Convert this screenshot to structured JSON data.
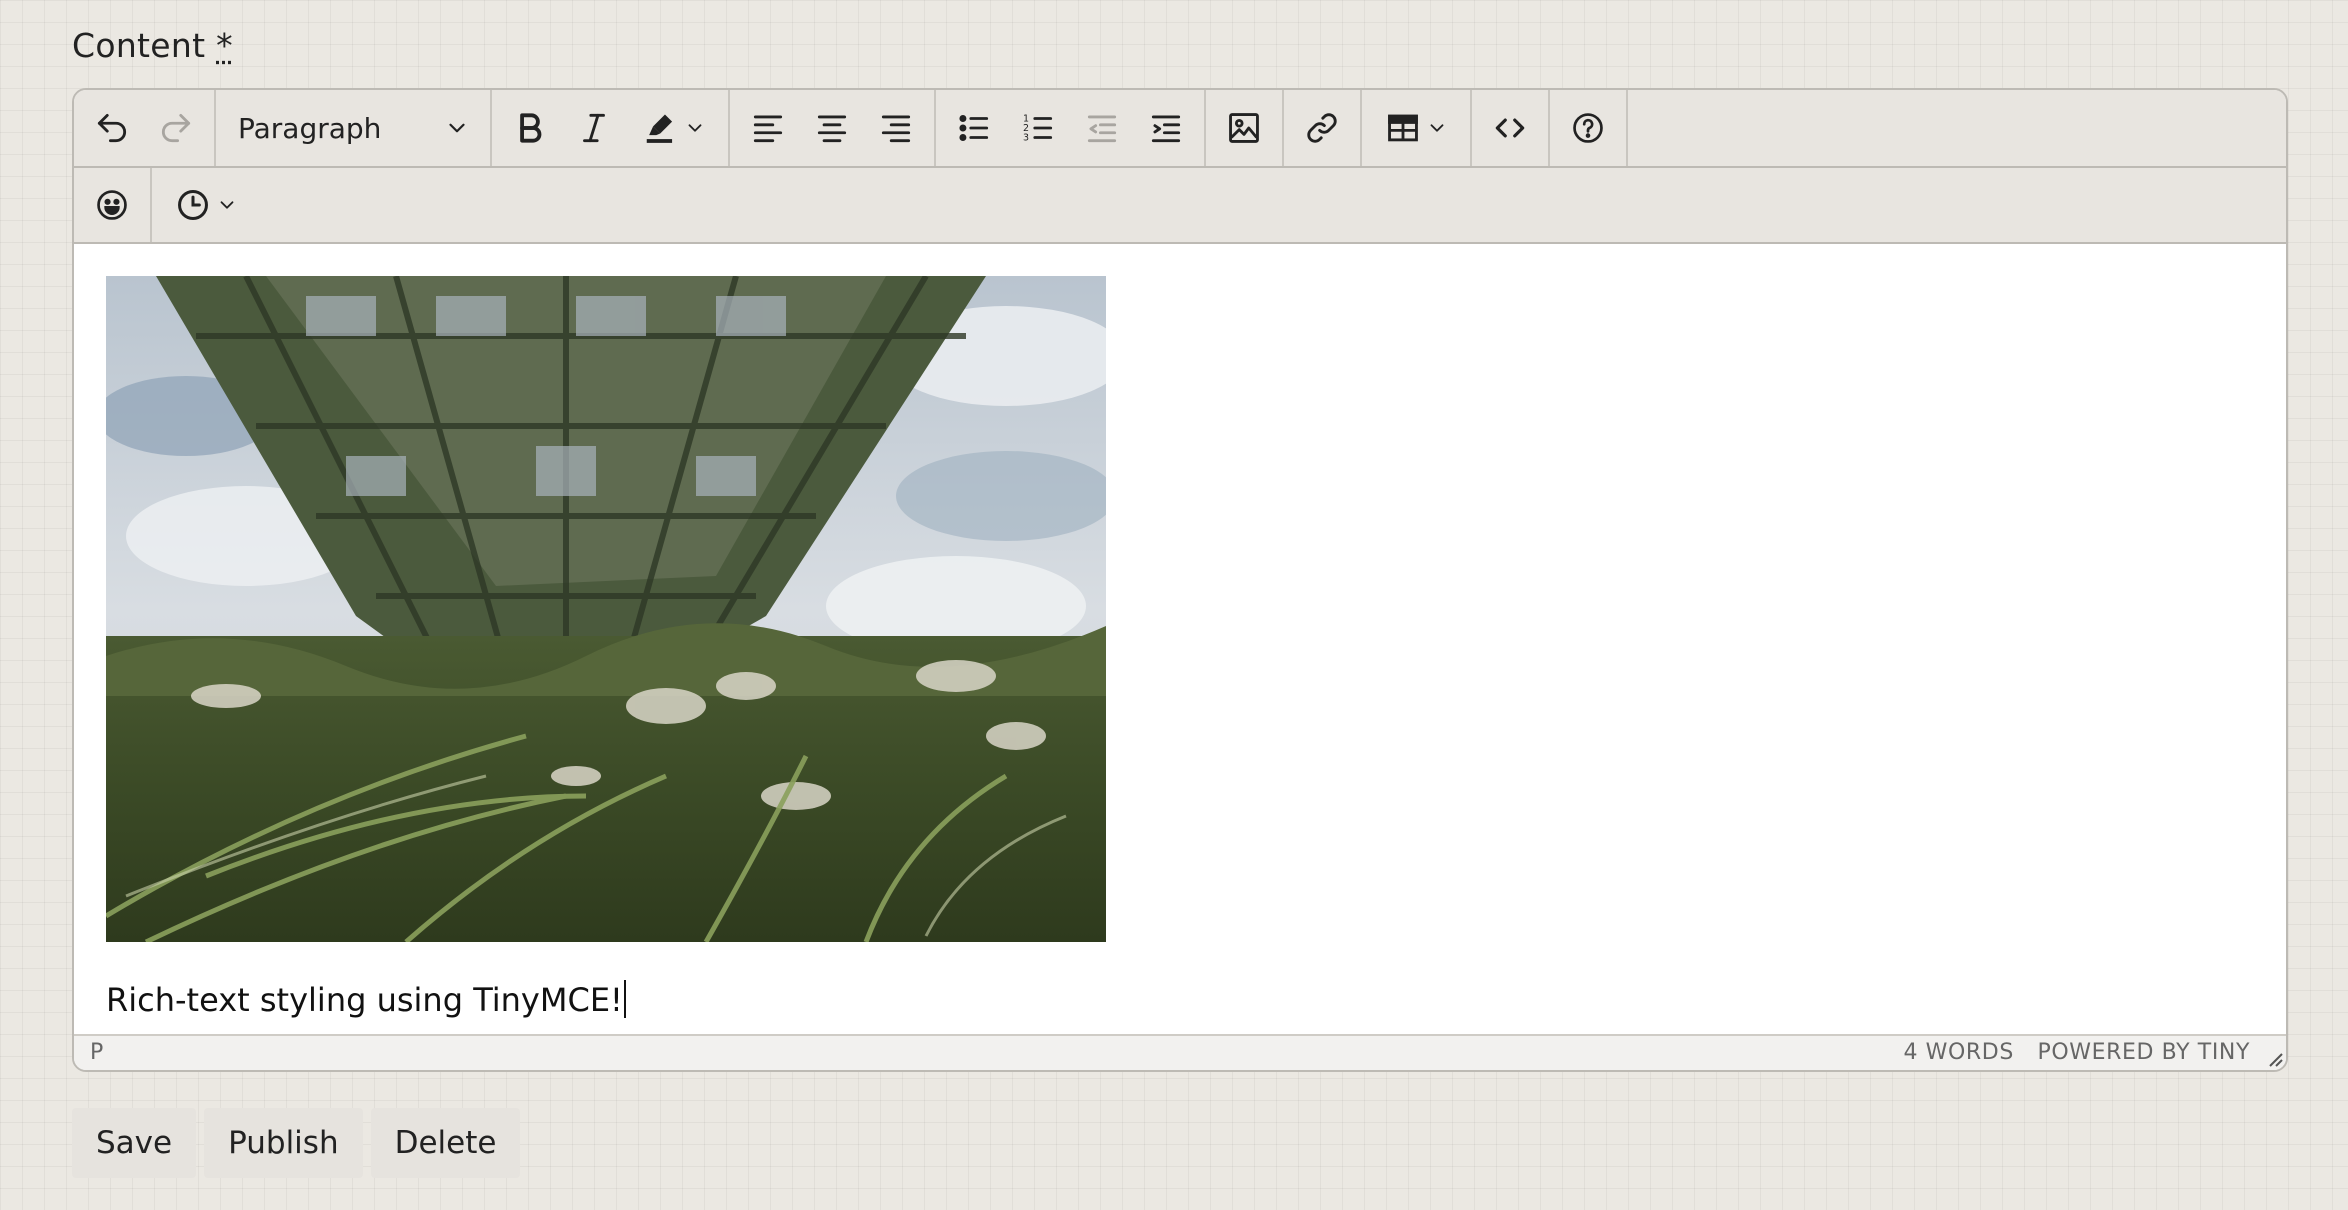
{
  "field": {
    "label": "Content",
    "required_mark": "*"
  },
  "toolbar": {
    "block_format": "Paragraph",
    "row1_icons": [
      "undo-icon",
      "redo-icon",
      "bold-icon",
      "italic-icon",
      "highlight-icon",
      "align-left-icon",
      "align-center-icon",
      "align-right-icon",
      "bullet-list-icon",
      "numbered-list-icon",
      "outdent-icon",
      "indent-icon",
      "image-icon",
      "link-icon",
      "table-icon",
      "code-icon",
      "help-icon"
    ],
    "row2_icons": [
      "emoji-icon",
      "clock-icon"
    ]
  },
  "content": {
    "paragraph": "Rich-text styling using TinyMCE!"
  },
  "statusbar": {
    "path": "P",
    "word_count": "4 WORDS",
    "branding": "POWERED BY TINY"
  },
  "actions": {
    "save": "Save",
    "publish": "Publish",
    "delete": "Delete"
  }
}
